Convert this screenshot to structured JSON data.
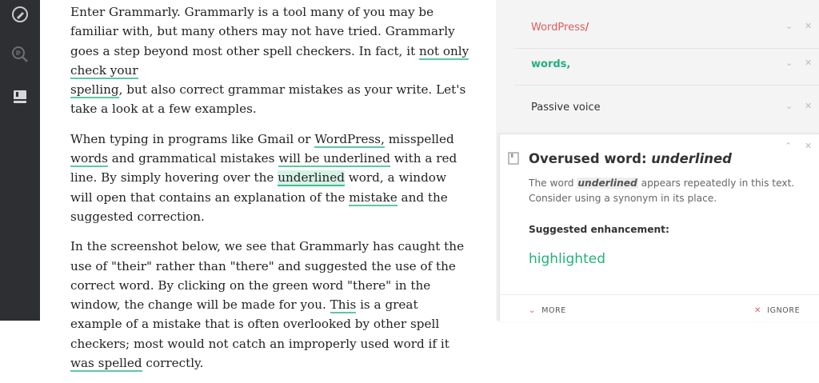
{
  "sidebar": {
    "icons": [
      "pen-icon",
      "search-icon",
      "book-icon"
    ]
  },
  "document": {
    "p1_a": "Enter Grammarly. Grammarly is a tool many of you may be familiar with, but many others may not have tried. Grammarly goes a step beyond most other spell checkers. In fact, it ",
    "p1_u1": "not only check your",
    "p1_u2": "spelling",
    "p1_b": ", but also correct grammar mistakes as your write. Let's take a look at a few examples.",
    "p2_a": "When typing in programs like Gmail or ",
    "p2_u1": "WordPress,",
    "p2_b": " misspelled ",
    "p2_u2": "words",
    "p2_c": " and grammatical mistakes ",
    "p2_u3": "will be underlined",
    "p2_d": " with a red line. By simply hovering over the ",
    "p2_u4": "underlined",
    "p2_e": " word, a window will open that contains an explanation of the ",
    "p2_u5": "mistake",
    "p2_f": " and the suggested correction.",
    "p3_a": "In the screenshot below, we see that Grammarly has caught the use of \"their\" rather than \"there\" and suggested the use of the correct word. By clicking on the green word \"there\" in the window, the change will be made for you. ",
    "p3_u1": "This",
    "p3_b": " is a great example of a mistake that is often overlooked by other spell checkers; most would not catch an improperly used word if it ",
    "p3_u2": "was spelled",
    "p3_c": " correctly."
  },
  "cards": [
    {
      "label": "WordPress",
      "mark": "/"
    },
    {
      "label": "words",
      "mark": ","
    },
    {
      "label": "Passive voice",
      "mark": ""
    }
  ],
  "detail": {
    "title_prefix": "Overused word: ",
    "title_word": "underlined",
    "desc_a": "The word ",
    "desc_kw": "underlined",
    "desc_b": " appears repeatedly in this text. Consider using a synonym in its place.",
    "suggest_heading": "Suggested enhancement:",
    "suggestion": "highlighted",
    "more_label": "MORE",
    "ignore_label": "IGNORE"
  },
  "colors": {
    "rail": "#2d2f33",
    "accent_green": "#23b07a",
    "error_red": "#e35b5b"
  }
}
